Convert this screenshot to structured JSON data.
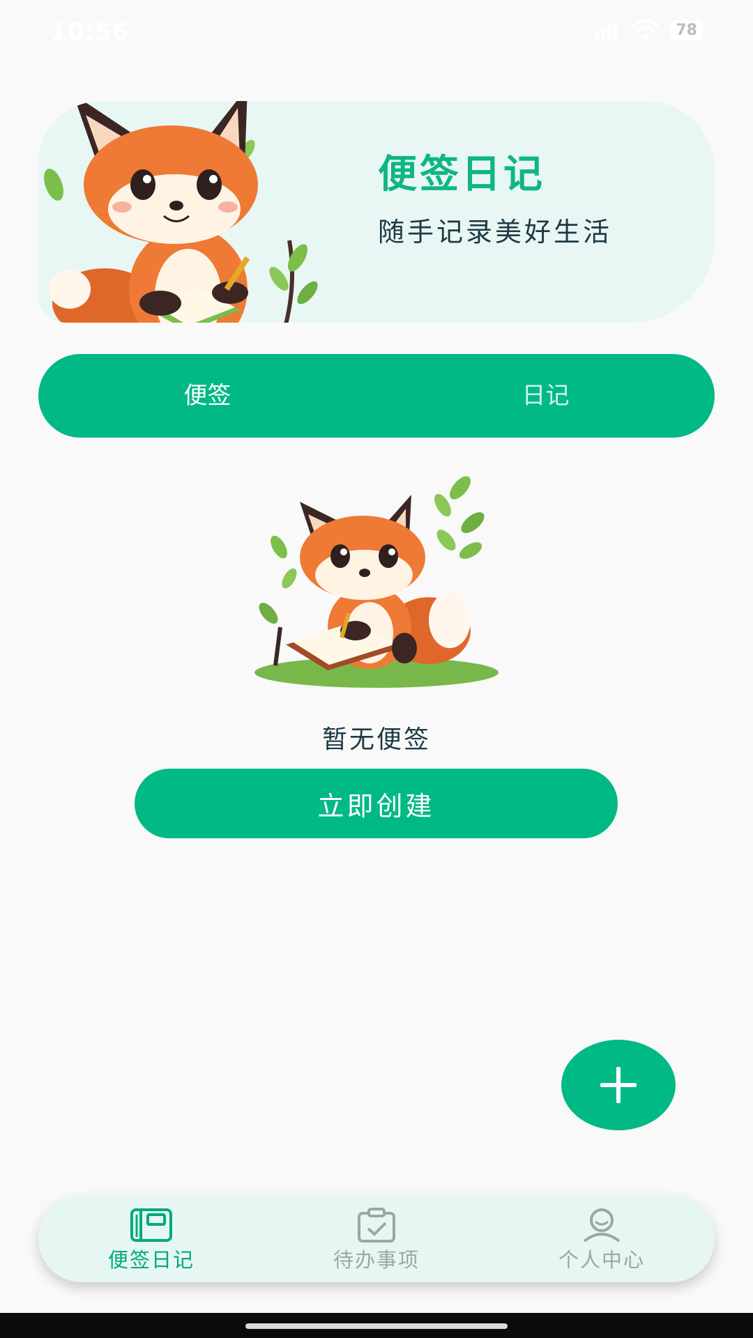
{
  "status_bar": {
    "time": "10:56",
    "battery": "78"
  },
  "hero": {
    "title": "便签日记",
    "subtitle": "随手记录美好生活"
  },
  "tabs": [
    {
      "label": "便签",
      "selected": true
    },
    {
      "label": "日记",
      "selected": false
    }
  ],
  "empty_state": {
    "message": "暂无便签",
    "button_label": "立即创建"
  },
  "fab": {
    "icon": "plus-icon"
  },
  "bottom_nav": [
    {
      "label": "便签日记",
      "icon": "notebook-icon",
      "active": true
    },
    {
      "label": "待办事项",
      "icon": "clipboard-check-icon",
      "active": false
    },
    {
      "label": "个人中心",
      "icon": "user-icon",
      "active": false
    }
  ],
  "colors": {
    "accent": "#00b985",
    "hero_bg": "#e8f7f4",
    "nav_bg": "#e6f7f3",
    "text": "#1d3a44",
    "inactive": "#9aa7a4"
  }
}
